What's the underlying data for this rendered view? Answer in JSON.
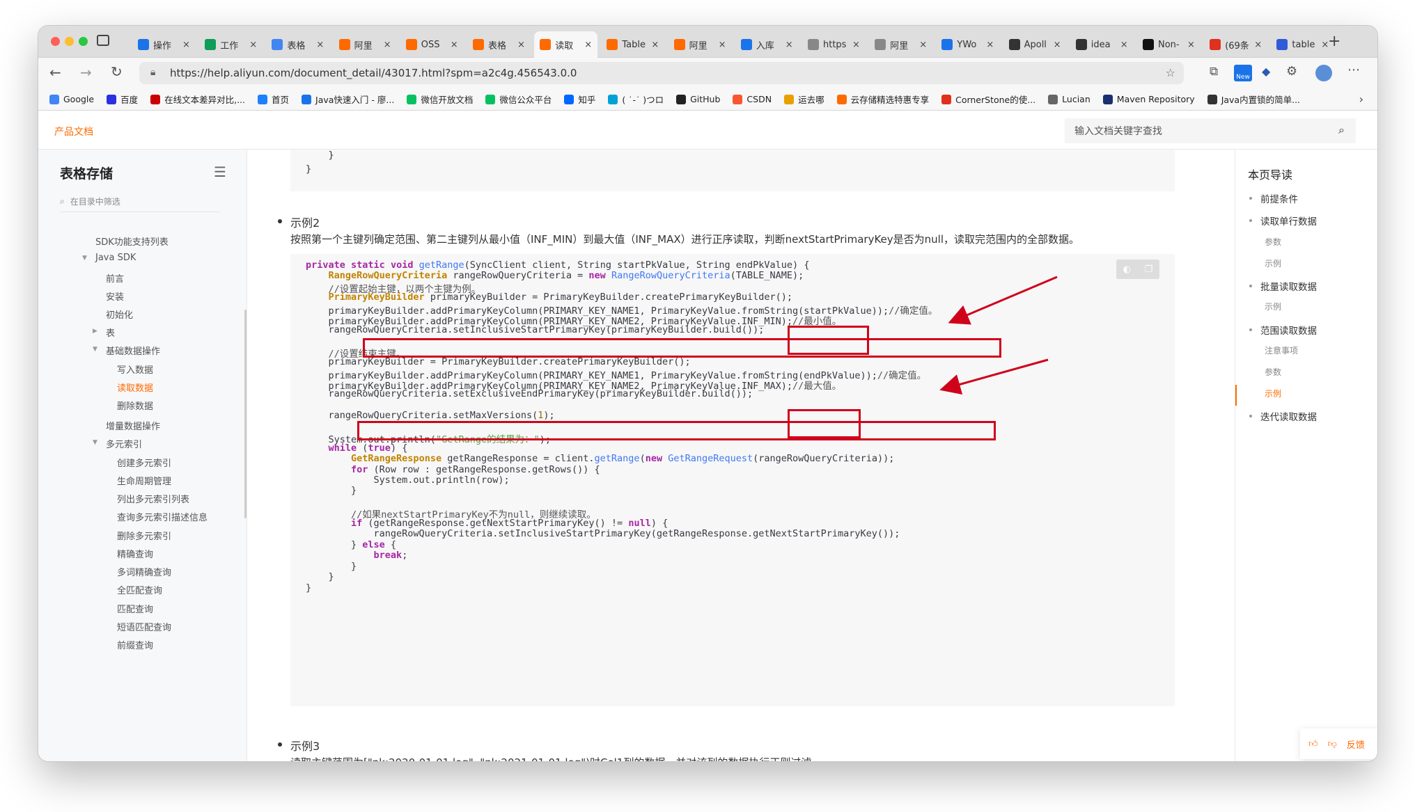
{
  "browser": {
    "tabs": [
      {
        "title": "操作",
        "color": "#1a73e8",
        "glyph": "On"
      },
      {
        "title": "工作",
        "color": "#0f9d58",
        "glyph": "▦"
      },
      {
        "title": "表格",
        "color": "#4285f4",
        "glyph": "▤"
      },
      {
        "title": "阿里",
        "color": "#ff6a00",
        "glyph": "{-}"
      },
      {
        "title": "OSS",
        "color": "#ff6a00",
        "glyph": "{-}"
      },
      {
        "title": "表格",
        "color": "#ff6a00",
        "glyph": "{-}"
      },
      {
        "title": "读取",
        "color": "#ff6a00",
        "glyph": "{-}"
      },
      {
        "title": "Table",
        "color": "#ff6a00",
        "glyph": "{-}"
      },
      {
        "title": "阿里",
        "color": "#ff6a00",
        "glyph": "{-}"
      },
      {
        "title": "入库",
        "color": "#1a73e8",
        "glyph": "辶"
      },
      {
        "title": "https",
        "color": "#888",
        "glyph": "▢"
      },
      {
        "title": "阿里",
        "color": "#888",
        "glyph": "⟦"
      },
      {
        "title": "YWo",
        "color": "#1a73e8",
        "glyph": "▣"
      },
      {
        "title": "Apoll",
        "color": "#333",
        "glyph": "⚲"
      },
      {
        "title": "idea",
        "color": "#333",
        "glyph": "◎"
      },
      {
        "title": "Non-",
        "color": "#111",
        "glyph": "■"
      },
      {
        "title": "(69条",
        "color": "#e0301e",
        "glyph": "C"
      },
      {
        "title": "table",
        "color": "#2f5bd8",
        "glyph": "☸"
      }
    ],
    "url": "https://help.aliyun.com/document_detail/43017.html?spm=a2c4g.456543.0.0",
    "bookmarks": [
      {
        "label": "Google",
        "color": "#4285f4",
        "glyph": "G"
      },
      {
        "label": "百度",
        "color": "#2932e1",
        "glyph": "🐾"
      },
      {
        "label": "在线文本差异对比,...",
        "color": "#c00",
        "glyph": "●"
      },
      {
        "label": "首页",
        "color": "#1e80ff",
        "glyph": "▲"
      },
      {
        "label": "Java快速入门 - 廖...",
        "color": "#1a73e8",
        "glyph": "✈"
      },
      {
        "label": "微信开放文档",
        "color": "#07c160",
        "glyph": "●"
      },
      {
        "label": "微信公众平台",
        "color": "#07c160",
        "glyph": "●"
      },
      {
        "label": "知乎",
        "color": "#0066ff",
        "glyph": "知"
      },
      {
        "label": "( ˙-˙ )つロ",
        "color": "#00a1d6",
        "glyph": "▭"
      },
      {
        "label": "GitHub",
        "color": "#222",
        "glyph": "◉"
      },
      {
        "label": "CSDN",
        "color": "#fc5531",
        "glyph": "C"
      },
      {
        "label": "运去哪",
        "color": "#e8a000",
        "glyph": "▭"
      },
      {
        "label": "云存储精选特惠专享",
        "color": "#ff6a00",
        "glyph": "{-}"
      },
      {
        "label": "CornerStone的使...",
        "color": "#e0301e",
        "glyph": "▣"
      },
      {
        "label": "Lucian",
        "color": "#666",
        "glyph": "▢"
      },
      {
        "label": "Maven Repository",
        "color": "#1b2e6f",
        "glyph": "m"
      },
      {
        "label": "Java内置锁的简单...",
        "color": "#333",
        "glyph": "◎"
      }
    ]
  },
  "site": {
    "logo": "产品文档",
    "search_placeholder": "输入文档关键字查找"
  },
  "sidebar": {
    "title": "表格存储",
    "filter_placeholder": "在目录中筛选",
    "items": [
      {
        "label": "SDK功能支持列表"
      },
      {
        "label": "Java SDK"
      },
      {
        "label": "前言"
      },
      {
        "label": "安装"
      },
      {
        "label": "初始化"
      },
      {
        "label": "表"
      },
      {
        "label": "基础数据操作"
      },
      {
        "label": "写入数据"
      },
      {
        "label": "读取数据"
      },
      {
        "label": "删除数据"
      },
      {
        "label": "增量数据操作"
      },
      {
        "label": "多元索引"
      },
      {
        "label": "创建多元索引"
      },
      {
        "label": "生命周期管理"
      },
      {
        "label": "列出多元索引列表"
      },
      {
        "label": "查询多元索引描述信息"
      },
      {
        "label": "删除多元索引"
      },
      {
        "label": "精确查询"
      },
      {
        "label": "多词精确查询"
      },
      {
        "label": "全匹配查询"
      },
      {
        "label": "匹配查询"
      },
      {
        "label": "短语匹配查询"
      },
      {
        "label": "前缀查询"
      }
    ]
  },
  "content": {
    "top_code": [
      "    }",
      "}"
    ],
    "example2_title": "示例2",
    "example2_desc": "按照第一个主键列确定范围、第二主键列从最小值（INF_MIN）到最大值（INF_MAX）进行正序读取，判断nextStartPrimaryKey是否为null，读取完范围内的全部数据。",
    "code": [
      "private static void getRange(SyncClient client, String startPkValue, String endPkValue) {",
      "    RangeRowQueryCriteria rangeRowQueryCriteria = new RangeRowQueryCriteria(TABLE_NAME);",
      "    //设置起始主键，以两个主键为例。",
      "    PrimaryKeyBuilder primaryKeyBuilder = PrimaryKeyBuilder.createPrimaryKeyBuilder();",
      "    primaryKeyBuilder.addPrimaryKeyColumn(PRIMARY_KEY_NAME1, PrimaryKeyValue.fromString(startPkValue));//确定值。",
      "    primaryKeyBuilder.addPrimaryKeyColumn(PRIMARY_KEY_NAME2, PrimaryKeyValue.INF_MIN);//最小值。",
      "    rangeRowQueryCriteria.setInclusiveStartPrimaryKey(primaryKeyBuilder.build());",
      "",
      "    //设置结束主键。",
      "    primaryKeyBuilder = PrimaryKeyBuilder.createPrimaryKeyBuilder();",
      "    primaryKeyBuilder.addPrimaryKeyColumn(PRIMARY_KEY_NAME1, PrimaryKeyValue.fromString(endPkValue));//确定值。",
      "    primaryKeyBuilder.addPrimaryKeyColumn(PRIMARY_KEY_NAME2, PrimaryKeyValue.INF_MAX);//最大值。",
      "    rangeRowQueryCriteria.setExclusiveEndPrimaryKey(primaryKeyBuilder.build());",
      "",
      "    rangeRowQueryCriteria.setMaxVersions(1);",
      "",
      "    System.out.println(\"GetRange的结果为：\");",
      "    while (true) {",
      "        GetRangeResponse getRangeResponse = client.getRange(new GetRangeRequest(rangeRowQueryCriteria));",
      "        for (Row row : getRangeResponse.getRows()) {",
      "            System.out.println(row);",
      "        }",
      "",
      "        //如果nextStartPrimaryKey不为null，则继续读取。",
      "        if (getRangeResponse.getNextStartPrimaryKey() != null) {",
      "            rangeRowQueryCriteria.setInclusiveStartPrimaryKey(getRangeResponse.getNextStartPrimaryKey());",
      "        } else {",
      "            break;",
      "        }",
      "    }",
      "}"
    ],
    "example3_title": "示例3",
    "example3_desc": "读取主键范围为[\"pk:2020-01-01.log\", \"pk:2021-01-01.log\")时Col1列的数据，并对该列的数据执行正则过滤。"
  },
  "toc": {
    "title": "本页导读",
    "items": [
      {
        "label": "前提条件"
      },
      {
        "label": "读取单行数据"
      },
      {
        "label": "参数"
      },
      {
        "label": "示例"
      },
      {
        "label": "批量读取数据"
      },
      {
        "label": "示例"
      },
      {
        "label": "范围读取数据"
      },
      {
        "label": "注意事项"
      },
      {
        "label": "参数"
      },
      {
        "label": "示例"
      },
      {
        "label": "迭代读取数据"
      }
    ]
  },
  "feedback": {
    "label": "反馈"
  },
  "colors": {
    "accent": "#ff6a00",
    "annotation_red": "#d0021b"
  }
}
